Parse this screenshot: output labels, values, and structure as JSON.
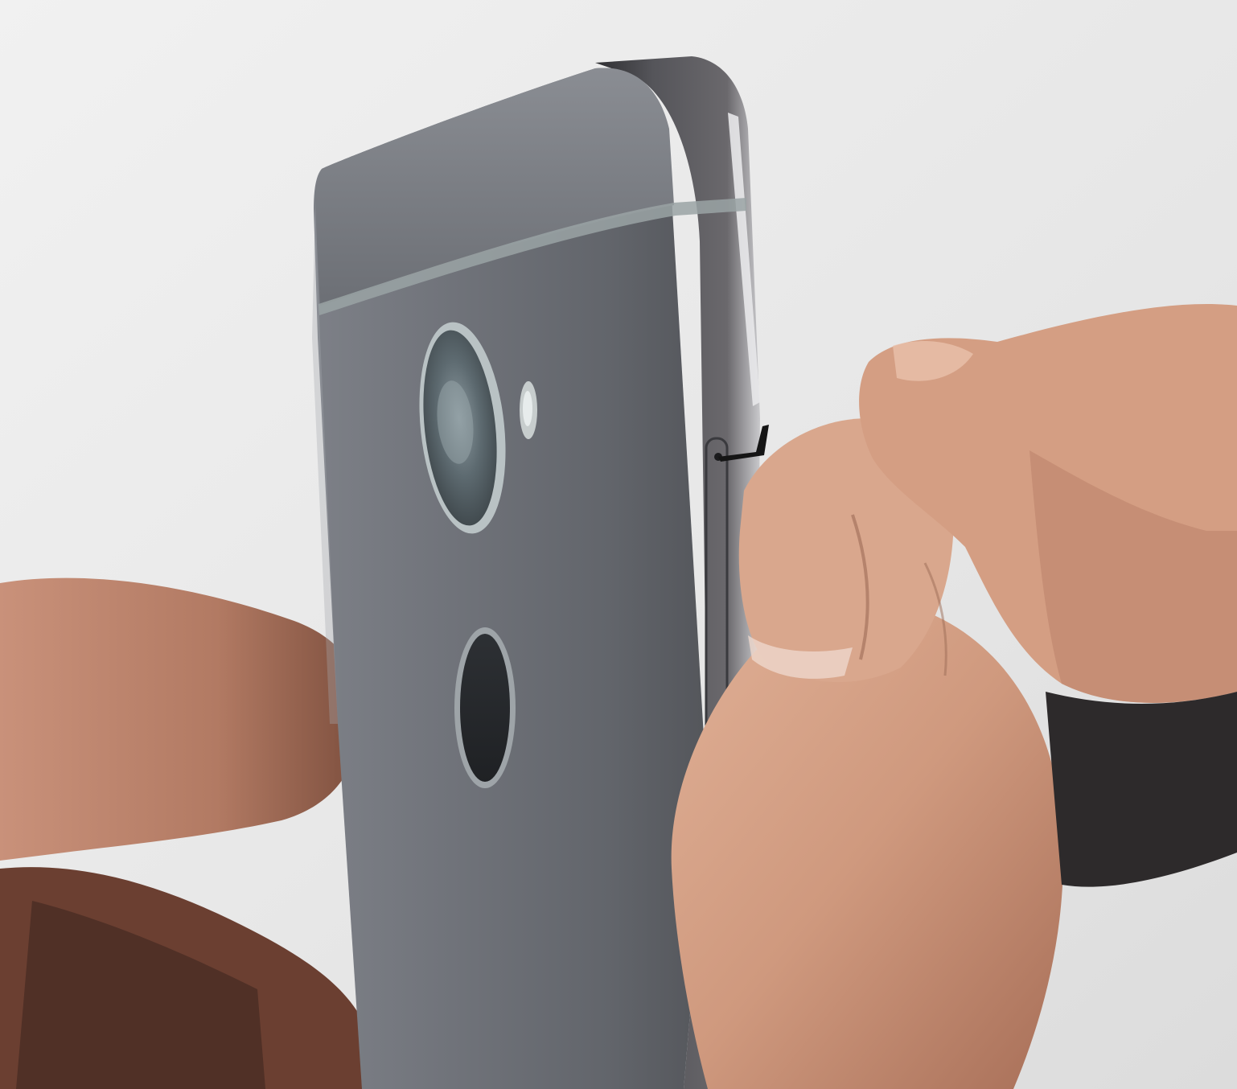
{
  "scene": {
    "subject": "phone-back-sim-tray-ejection",
    "colors": {
      "background": "#e9e9e9",
      "phone_body": "#6b6e74",
      "phone_frame": "#4b4b50",
      "skin_light": "#d7a48a",
      "skin_shadow": "#8a5a45"
    },
    "icons": [
      "camera-lens-icon",
      "flash-icon",
      "fingerprint-sensor-icon",
      "sim-eject-hole-icon"
    ]
  }
}
